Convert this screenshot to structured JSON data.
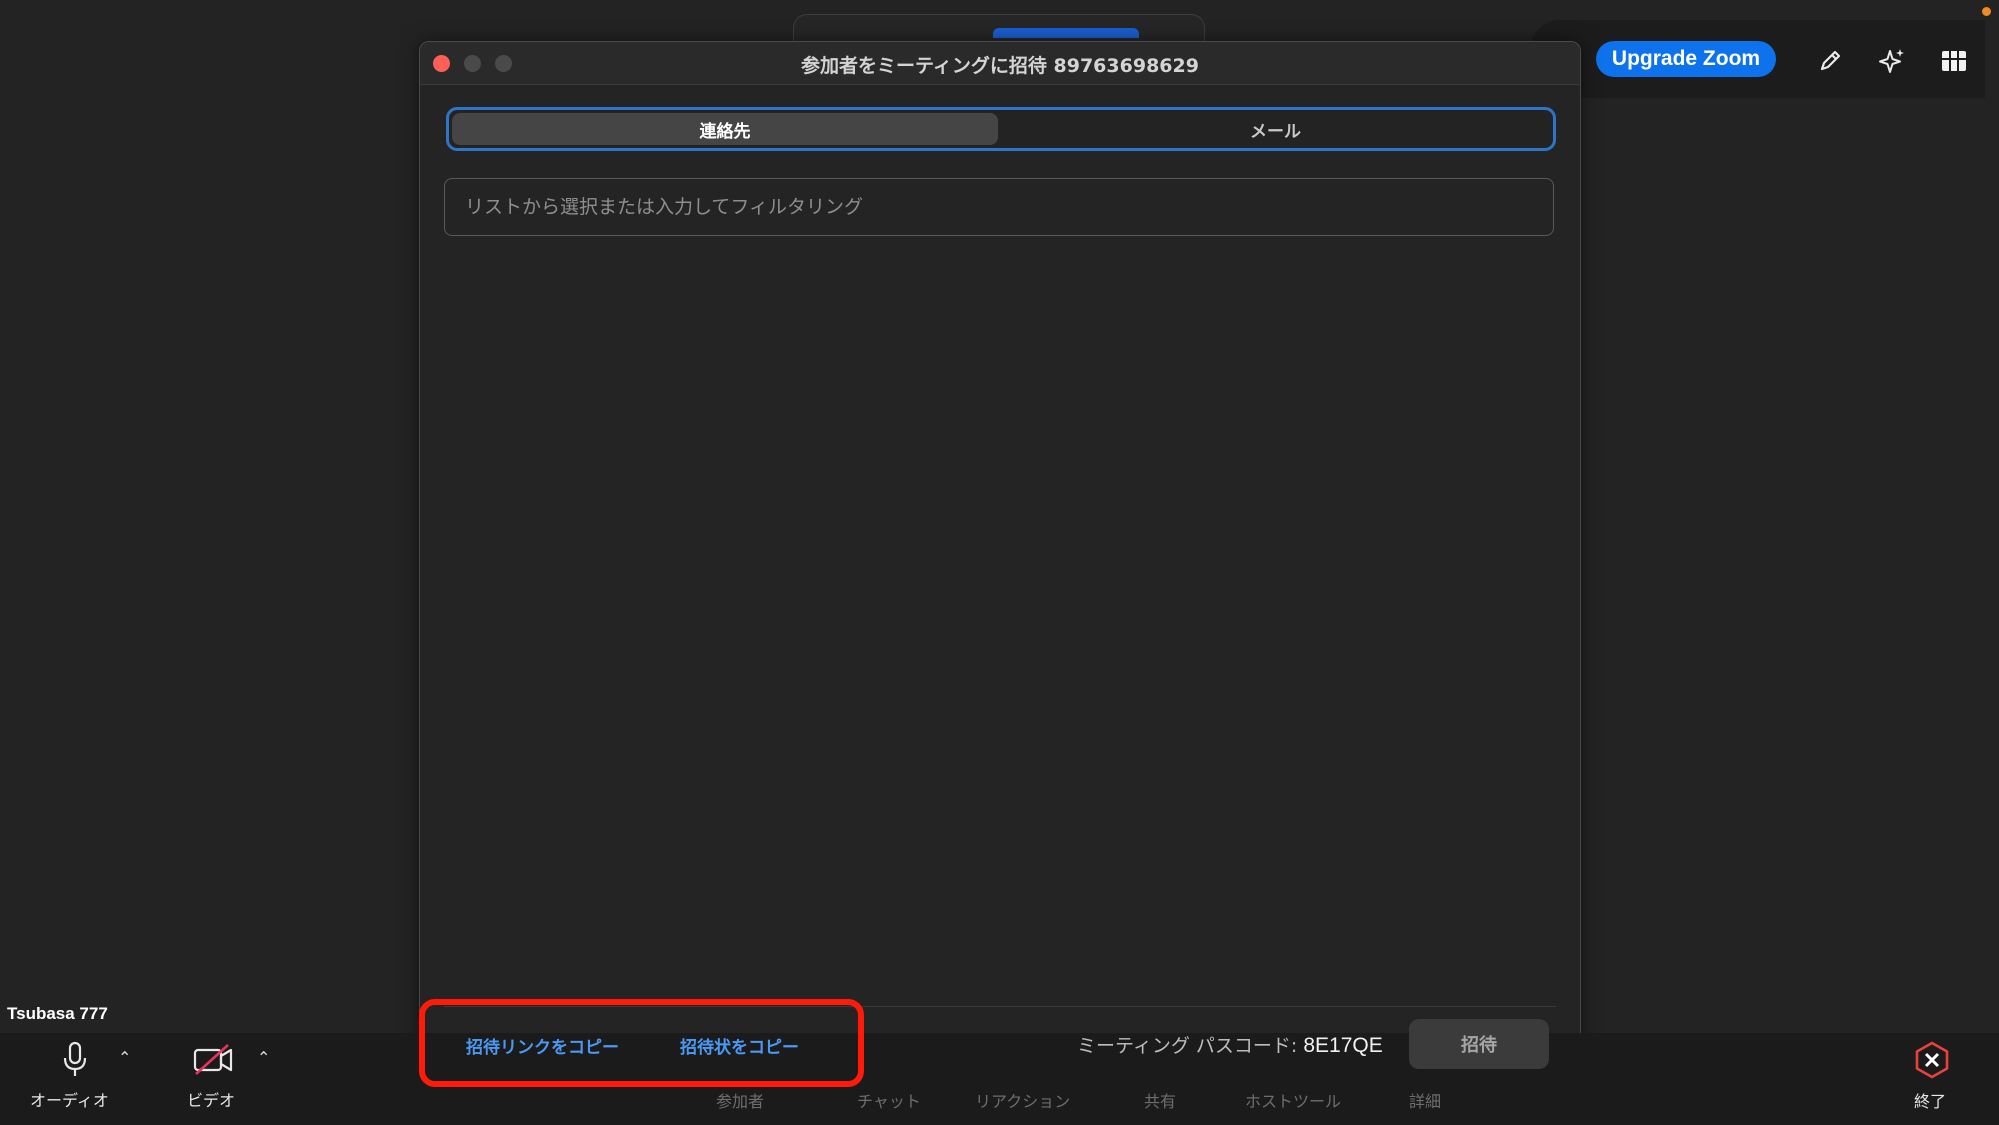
{
  "dialog": {
    "title": "参加者をミーティングに招待 89763698629",
    "tabs": {
      "contacts": "連絡先",
      "email": "メール"
    },
    "filter_placeholder": "リストから選択または入力してフィルタリング",
    "copy_link": "招待リンクをコピー",
    "copy_invitation": "招待状をコピー",
    "passcode_label": "ミーティング パスコード:",
    "passcode_value": "8E17QE",
    "invite_button": "招待"
  },
  "top_right": {
    "upgrade_label": "Upgrade Zoom",
    "icons": [
      "edit-pen-icon",
      "sparkle-icon",
      "grid-view-icon"
    ]
  },
  "bottom_bar": {
    "user_name": "Tsubasa 777",
    "audio_label": "オーディオ",
    "video_label": "ビデオ",
    "participants": "参加者",
    "chat": "チャット",
    "reactions": "リアクション",
    "share": "共有",
    "host_tools": "ホストツール",
    "more": "詳細",
    "end": "終了"
  },
  "colors": {
    "accent_blue": "#0e72ed",
    "link_blue": "#4a9af5",
    "highlight_red": "#ff1a0a",
    "close_red": "#fe5f57",
    "end_red": "#e8423b"
  }
}
